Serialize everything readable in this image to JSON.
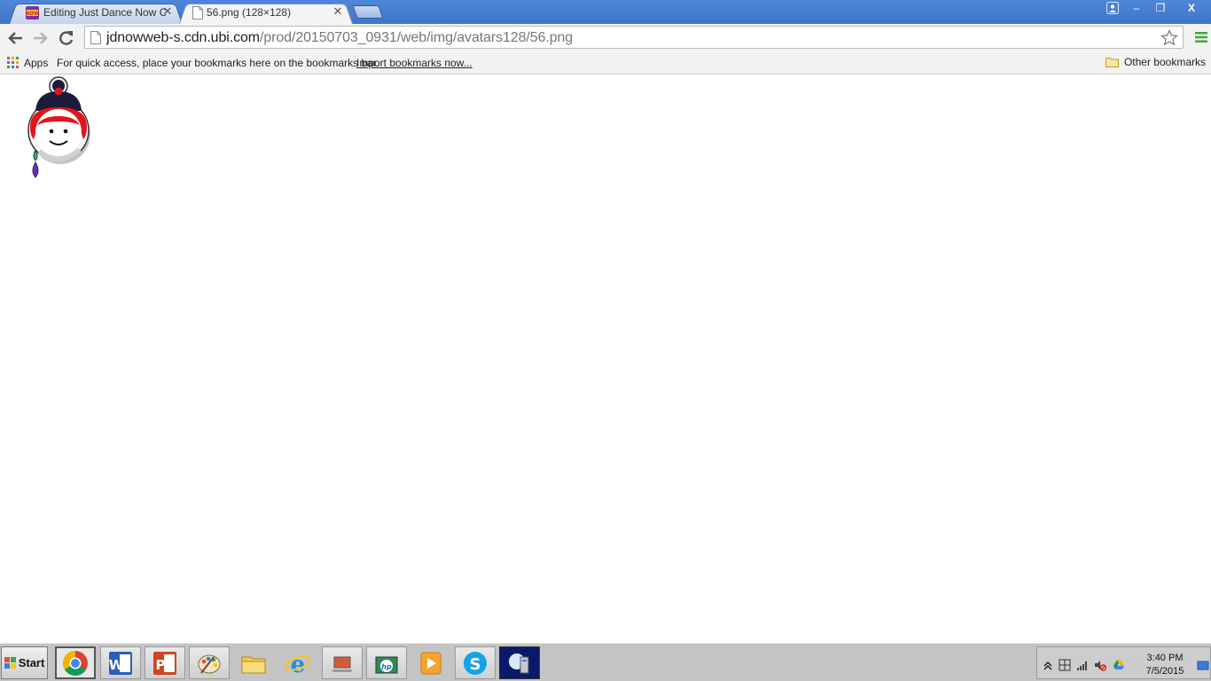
{
  "browser": {
    "tabs": [
      {
        "title": "Editing Just Dance Now Cod",
        "favicon": "just-dance-now-icon",
        "active": false
      },
      {
        "title": "56.png (128×128)",
        "favicon": "page-icon",
        "active": true
      }
    ],
    "url_host": "jdnowweb-s.cdn.ubi.com",
    "url_path": "/prod/20150703_0931/web/img/avatars128/56.png",
    "bookmarks_bar": {
      "apps_label": "Apps",
      "hint": "For quick access, place your bookmarks here on the bookmarks bar.",
      "import_link": "Import bookmarks now...",
      "other_bookmarks": "Other bookmarks"
    },
    "window_controls": {
      "minimize": "–",
      "restore": "❐",
      "close": "X"
    }
  },
  "content": {
    "image_icon": "avatar-character-icon"
  },
  "taskbar": {
    "start_label": "Start",
    "apps": [
      {
        "name": "chrome-icon"
      },
      {
        "name": "word-icon"
      },
      {
        "name": "powerpoint-icon"
      },
      {
        "name": "paint-icon"
      },
      {
        "name": "file-explorer-icon"
      },
      {
        "name": "internet-explorer-icon"
      },
      {
        "name": "laptop-icon"
      },
      {
        "name": "hp-icon"
      },
      {
        "name": "media-player-icon"
      },
      {
        "name": "skype-icon"
      },
      {
        "name": "network-computer-icon"
      }
    ],
    "clock": {
      "time": "3:40 PM",
      "date": "7/5/2015"
    }
  }
}
